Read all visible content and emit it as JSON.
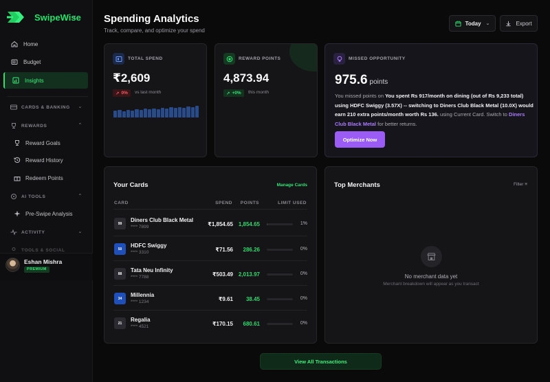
{
  "app": {
    "name": "SwipeWise"
  },
  "nav": {
    "home": "Home",
    "budget": "Budget",
    "insights": "Insights",
    "sections": {
      "cards_banking": "CARDS & BANKING",
      "rewards": "REWARDS",
      "ai_tools": "AI TOOLS",
      "activity": "ACTIVITY",
      "partial": "TOOLS & SOCIAL"
    },
    "reward_goals": "Reward Goals",
    "reward_history": "Reward History",
    "redeem_points": "Redeem Points",
    "pre_swipe": "Pre-Swipe Analysis"
  },
  "user": {
    "name": "Eshan Mishra",
    "badge": "PREMIUM"
  },
  "header": {
    "title": "Spending Analytics",
    "subtitle": "Track, compare, and optimize your spend",
    "period": "Today",
    "export": "Export"
  },
  "total_spend": {
    "label": "TOTAL SPEND",
    "value": "₹2,609",
    "delta": "0%",
    "delta_note": "vs last month",
    "sparkline": [
      0.55,
      0.6,
      0.5,
      0.62,
      0.58,
      0.66,
      0.6,
      0.7,
      0.64,
      0.74,
      0.68,
      0.78,
      0.72,
      0.82,
      0.76,
      0.86,
      0.8,
      0.88,
      0.84,
      0.92
    ]
  },
  "reward_points": {
    "label": "REWARD POINTS",
    "value": "4,873.94",
    "delta": "+0%",
    "delta_note": "this month"
  },
  "missed": {
    "label": "MISSED OPPORTUNITY",
    "value": "975.6",
    "unit": "points",
    "text_a": "You missed points on ",
    "text_b": "You spent Rs 917/month on dining (out of Rs 9,233 total) using HDFC Swiggy (3.57X) -- switching to Diners Club Black Metal (10.0X) would earn 210 extra points/month worth Rs 136.",
    "text_c": " using Current Card. Switch to ",
    "text_d": "Diners Club Black Metal",
    "text_e": " for better returns.",
    "button": "Optimize Now"
  },
  "your_cards": {
    "title": "Your Cards",
    "manage": "Manage Cards",
    "headers": {
      "card": "CARD",
      "spend": "SPEND",
      "points": "POINTS",
      "limit": "LIMIT USED"
    },
    "rows": [
      {
        "chip": "99",
        "chip_color": "#2a2a30",
        "name": "Diners Club Black Metal",
        "num": "**** 7899",
        "spend": "₹1,854.65",
        "points": "1,854.65",
        "limit": "1%",
        "limit_frac": 0.01
      },
      {
        "chip": "50",
        "chip_color": "#1f4fb8",
        "name": "HDFC Swiggy",
        "num": "**** 3310",
        "spend": "₹71.56",
        "points": "286.26",
        "limit": "0%",
        "limit_frac": 0
      },
      {
        "chip": "88",
        "chip_color": "#2a2a30",
        "name": "Tata Neu Infinity",
        "num": "**** 7788",
        "spend": "₹503.49",
        "points": "2,013.97",
        "limit": "0%",
        "limit_frac": 0
      },
      {
        "chip": "34",
        "chip_color": "#1f4fb8",
        "name": "Millennia",
        "num": "**** 1234",
        "spend": "₹9.61",
        "points": "38.45",
        "limit": "0%",
        "limit_frac": 0
      },
      {
        "chip": "21",
        "chip_color": "#2a2a30",
        "name": "Regalia",
        "num": "**** 4521",
        "spend": "₹170.15",
        "points": "680.61",
        "limit": "0%",
        "limit_frac": 0
      }
    ]
  },
  "merchants": {
    "title": "Top Merchants",
    "filter": "Filter",
    "empty_title": "No merchant data yet",
    "empty_sub": "Merchant breakdown will appear as you transact"
  },
  "view_all": "View All Transactions",
  "colors": {
    "accent": "#22e36a",
    "purple": "#9a5cf5",
    "spark": "#2a4b8a"
  }
}
